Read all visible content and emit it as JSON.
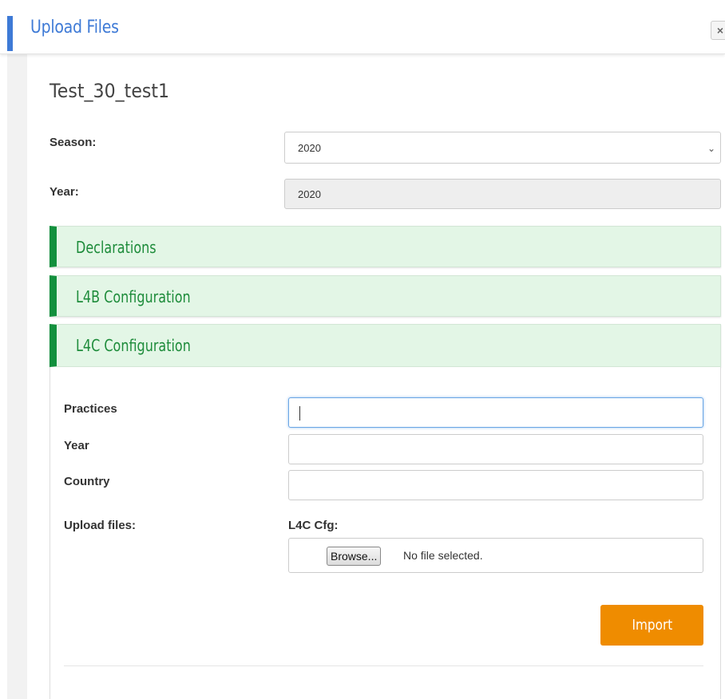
{
  "header": {
    "title": "Upload Files",
    "close_label": "×"
  },
  "dialog": {
    "title": "Test_30_test1"
  },
  "season": {
    "label": "Season:",
    "value": "2020"
  },
  "year_top": {
    "label": "Year:",
    "value": "2020"
  },
  "accordion": {
    "declarations": "Declarations",
    "l4b": "L4B Configuration",
    "l4c": "L4C Configuration"
  },
  "form": {
    "practices_label": "Practices",
    "practices_value": "",
    "year_label": "Year",
    "year_value": "",
    "country_label": "Country",
    "country_value": "",
    "upload_label": "Upload files:",
    "cfg_label": "L4C Cfg:",
    "browse_label": "Browse...",
    "no_file_text": "No file selected."
  },
  "import_button": "Import",
  "colors": {
    "accent_blue": "#3e7ad6",
    "accordion_green": "#12903d",
    "accordion_bg": "#e3f6e6",
    "import_orange": "#ef8c00"
  },
  "icons": {
    "close": "close-icon",
    "select_chevron": "chevron-down-icon"
  }
}
